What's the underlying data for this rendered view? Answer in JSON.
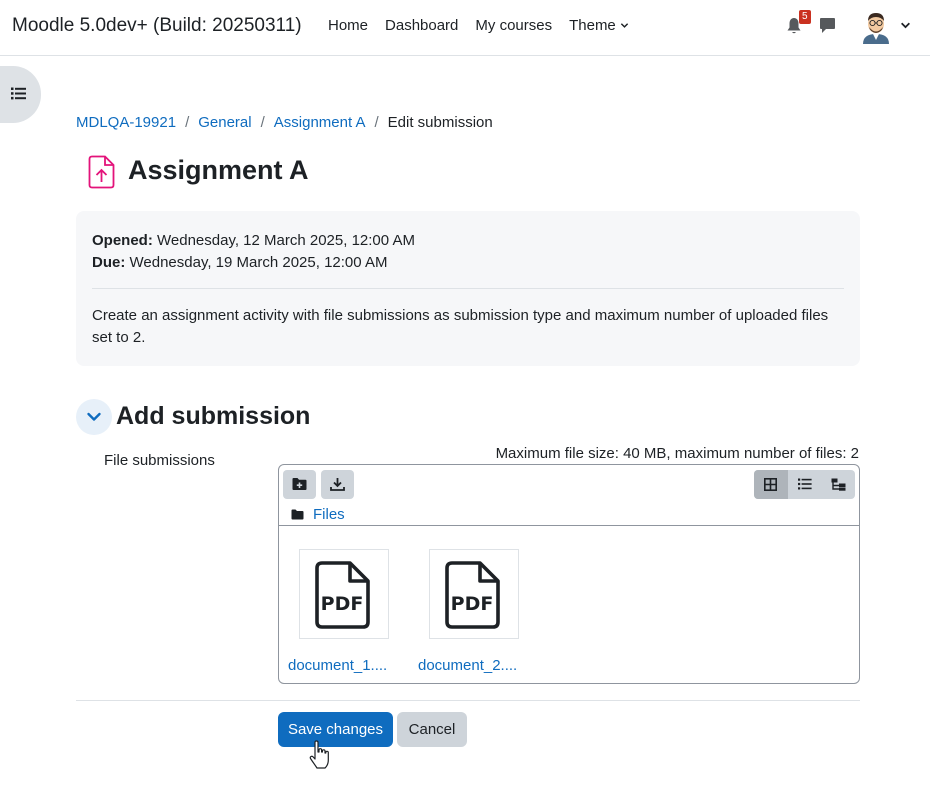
{
  "navbar": {
    "site_name": "Moodle 5.0dev+ (Build: 20250311)",
    "links": [
      "Home",
      "Dashboard",
      "My courses",
      "Theme"
    ],
    "notification_count": "5",
    "icons": [
      "bell-icon",
      "chat-icon",
      "avatar",
      "chevron-down-icon"
    ]
  },
  "breadcrumb": {
    "items": [
      "MDLQA-19921",
      "General",
      "Assignment A"
    ],
    "current": "Edit submission"
  },
  "page": {
    "title": "Assignment A"
  },
  "info": {
    "opened_label": "Opened:",
    "opened_value": "Wednesday, 12 March 2025, 12:00 AM",
    "due_label": "Due:",
    "due_value": "Wednesday, 19 March 2025, 12:00 AM",
    "intro": "Create an assignment activity with file submissions as submission type and maximum number of uploaded files set to 2."
  },
  "section": {
    "title": "Add submission",
    "field_label": "File submissions",
    "limits": "Maximum file size: 40 MB, maximum number of files: 2"
  },
  "filemanager": {
    "path_label": "Files",
    "files": [
      {
        "name": "document_1...."
      },
      {
        "name": "document_2...."
      }
    ],
    "file_type_label": "PDF"
  },
  "buttons": {
    "save": "Save changes",
    "cancel": "Cancel"
  },
  "colors": {
    "link": "#0f6cbf",
    "primary": "#0f6cbf",
    "badge": "#ca3120",
    "activity_icon": "#e3137a"
  }
}
